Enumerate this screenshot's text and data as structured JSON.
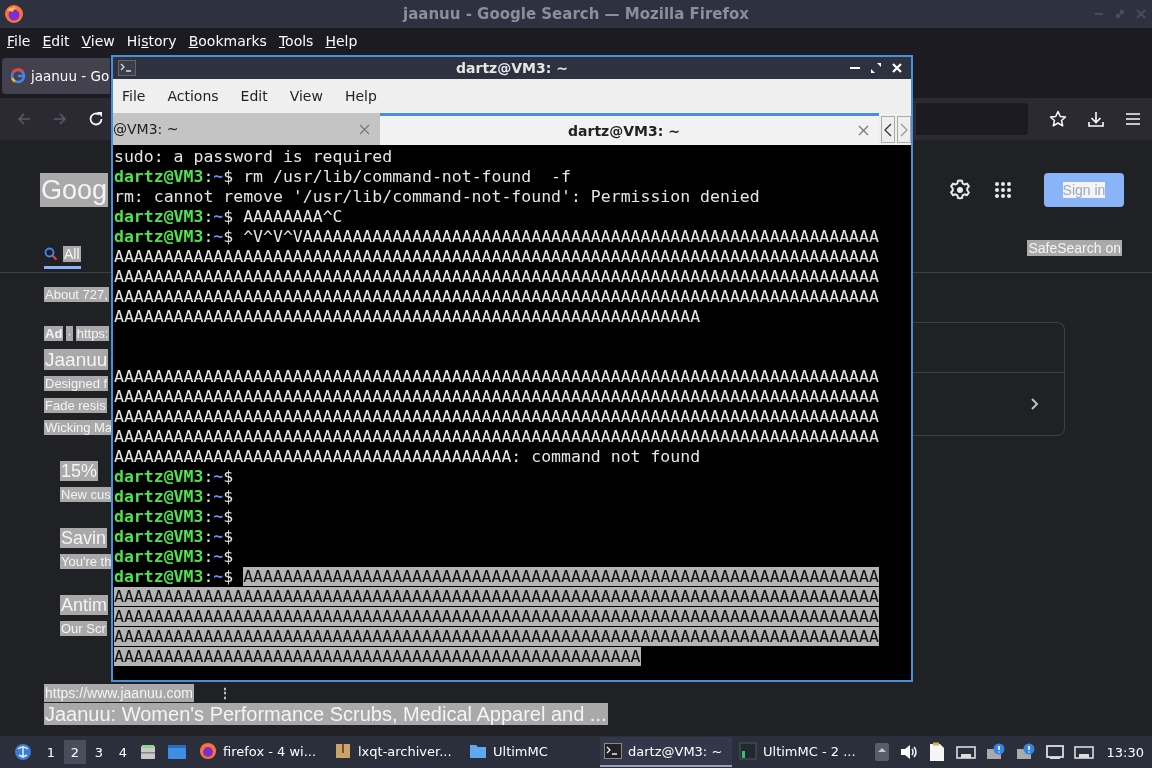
{
  "browser": {
    "title": "jaanuu - Google Search — Mozilla Firefox",
    "menu": [
      {
        "key": "F",
        "after": "ile"
      },
      {
        "key": "E",
        "after": "dit"
      },
      {
        "key": "V",
        "after": "iew"
      },
      {
        "before": "Hi",
        "key": "s",
        "after": "tory"
      },
      {
        "key": "B",
        "after": "ookmarks"
      },
      {
        "key": "T",
        "after": "ools"
      },
      {
        "key": "H",
        "after": "elp"
      }
    ],
    "tab": {
      "label": "jaanuu - Go"
    }
  },
  "google": {
    "text_selected": true,
    "logo": "Goog",
    "sign_in": "Sign in",
    "tabs": [
      {
        "label": "All",
        "selected": true
      }
    ],
    "safesearch": "SafeSearch on",
    "stats": "About 727,",
    "ad": {
      "badge": "Ad",
      "dot": "·",
      "url": "https:"
    },
    "ad_title": "Jaanuu",
    "ad_lines": [
      "Designed f",
      "Fade resis",
      "Wicking Ma"
    ],
    "sitelinks": [
      {
        "title": "15%",
        "text": "New cus"
      },
      {
        "title": "Savin",
        "text": "You're th"
      },
      {
        "title": "Antim",
        "text": "Our Scr"
      }
    ],
    "result": {
      "url": "https://www.jaanuu.com",
      "more": "⋮",
      "title": "Jaanuu: Women's Performance Scrubs, Medical Apparel and ..."
    }
  },
  "terminal": {
    "title": "dartz@VM3: ~",
    "menu": [
      "File",
      "Actions",
      "Edit",
      "View",
      "Help"
    ],
    "tabs": [
      {
        "label": "@VM3: ~",
        "selected": false
      },
      {
        "label": "dartz@VM3: ~",
        "selected": true
      }
    ],
    "lines": [
      {
        "kind": "output",
        "text": "sudo: a password is required"
      },
      {
        "kind": "prompt",
        "user": "dartz@VM3",
        "sep": ":",
        "path": "~",
        "sign": "$",
        "command": "rm /usr/lib/command-not-found  -f"
      },
      {
        "kind": "output",
        "text": "rm: cannot remove '/usr/lib/command-not-found': Permission denied"
      },
      {
        "kind": "prompt",
        "user": "dartz@VM3",
        "sep": ":",
        "path": "~",
        "sign": "$",
        "command": "AAAAAAAA^C"
      },
      {
        "kind": "prompt",
        "user": "dartz@VM3",
        "sep": ":",
        "path": "~",
        "sign": "$",
        "command": "^V^V^VAAAAAAAAAAAAAAAAAAAAAAAAAAAAAAAAAAAAAAAAAAAAAAAAAAAAAAAAAA"
      },
      {
        "kind": "output",
        "text": "AAAAAAAAAAAAAAAAAAAAAAAAAAAAAAAAAAAAAAAAAAAAAAAAAAAAAAAAAAAAAAAAAAAAAAAAAAAAA"
      },
      {
        "kind": "output",
        "text": "AAAAAAAAAAAAAAAAAAAAAAAAAAAAAAAAAAAAAAAAAAAAAAAAAAAAAAAAAAAAAAAAAAAAAAAAAAAAA"
      },
      {
        "kind": "output",
        "text": "AAAAAAAAAAAAAAAAAAAAAAAAAAAAAAAAAAAAAAAAAAAAAAAAAAAAAAAAAAAAAAAAAAAAAAAAAAAAA"
      },
      {
        "kind": "output",
        "text": "AAAAAAAAAAAAAAAAAAAAAAAAAAAAAAAAAAAAAAAAAAAAAAAAAAAAAAAAAAA"
      },
      {
        "kind": "blank"
      },
      {
        "kind": "blank"
      },
      {
        "kind": "output",
        "text": "AAAAAAAAAAAAAAAAAAAAAAAAAAAAAAAAAAAAAAAAAAAAAAAAAAAAAAAAAAAAAAAAAAAAAAAAAAAAA"
      },
      {
        "kind": "output",
        "text": "AAAAAAAAAAAAAAAAAAAAAAAAAAAAAAAAAAAAAAAAAAAAAAAAAAAAAAAAAAAAAAAAAAAAAAAAAAAAA"
      },
      {
        "kind": "output",
        "text": "AAAAAAAAAAAAAAAAAAAAAAAAAAAAAAAAAAAAAAAAAAAAAAAAAAAAAAAAAAAAAAAAAAAAAAAAAAAAA"
      },
      {
        "kind": "output",
        "text": "AAAAAAAAAAAAAAAAAAAAAAAAAAAAAAAAAAAAAAAAAAAAAAAAAAAAAAAAAAAAAAAAAAAAAAAAAAAAA"
      },
      {
        "kind": "output",
        "text": "AAAAAAAAAAAAAAAAAAAAAAAAAAAAAAAAAAAAAAAA: command not found"
      },
      {
        "kind": "prompt",
        "user": "dartz@VM3",
        "sep": ":",
        "path": "~",
        "sign": "$"
      },
      {
        "kind": "prompt",
        "user": "dartz@VM3",
        "sep": ":",
        "path": "~",
        "sign": "$"
      },
      {
        "kind": "prompt",
        "user": "dartz@VM3",
        "sep": ":",
        "path": "~",
        "sign": "$"
      },
      {
        "kind": "prompt",
        "user": "dartz@VM3",
        "sep": ":",
        "path": "~",
        "sign": "$"
      },
      {
        "kind": "prompt",
        "user": "dartz@VM3",
        "sep": ":",
        "path": "~",
        "sign": "$"
      },
      {
        "kind": "prompt",
        "user": "dartz@VM3",
        "sep": ":",
        "path": "~",
        "sign": "$",
        "command": "AAAAAAAAAAAAAAAAAAAAAAAAAAAAAAAAAAAAAAAAAAAAAAAAAAAAAAAAAAAAAAAA",
        "selected": true
      },
      {
        "kind": "output",
        "text": "AAAAAAAAAAAAAAAAAAAAAAAAAAAAAAAAAAAAAAAAAAAAAAAAAAAAAAAAAAAAAAAAAAAAAAAAAAAAA",
        "selected": true
      },
      {
        "kind": "output",
        "text": "AAAAAAAAAAAAAAAAAAAAAAAAAAAAAAAAAAAAAAAAAAAAAAAAAAAAAAAAAAAAAAAAAAAAAAAAAAAAA",
        "selected": true
      },
      {
        "kind": "output",
        "text": "AAAAAAAAAAAAAAAAAAAAAAAAAAAAAAAAAAAAAAAAAAAAAAAAAAAAAAAAAAAAAAAAAAAAAAAAAAAAA",
        "selected": true
      },
      {
        "kind": "output",
        "text": "AAAAAAAAAAAAAAAAAAAAAAAAAAAAAAAAAAAAAAAAAAAAAAAAAAAAA",
        "selected": true
      }
    ]
  },
  "taskbar": {
    "desktops": [
      {
        "label": "1",
        "selected": false
      },
      {
        "label": "2",
        "selected": true
      },
      {
        "label": "3",
        "selected": false
      },
      {
        "label": "4",
        "selected": false
      }
    ],
    "tasks": [
      {
        "kind": "firefox",
        "label": "firefox - 4 wi...",
        "selected": false
      },
      {
        "kind": "archiver",
        "label": "lxqt-archiver...",
        "selected": false
      },
      {
        "kind": "folder",
        "label": "UltimMC",
        "selected": false
      },
      {
        "kind": "terminal",
        "label": "dartz@VM3: ~",
        "selected": true
      },
      {
        "kind": "launcher",
        "label": "UltimMC - 2 ...",
        "selected": false
      }
    ],
    "clock": "13:30"
  }
}
